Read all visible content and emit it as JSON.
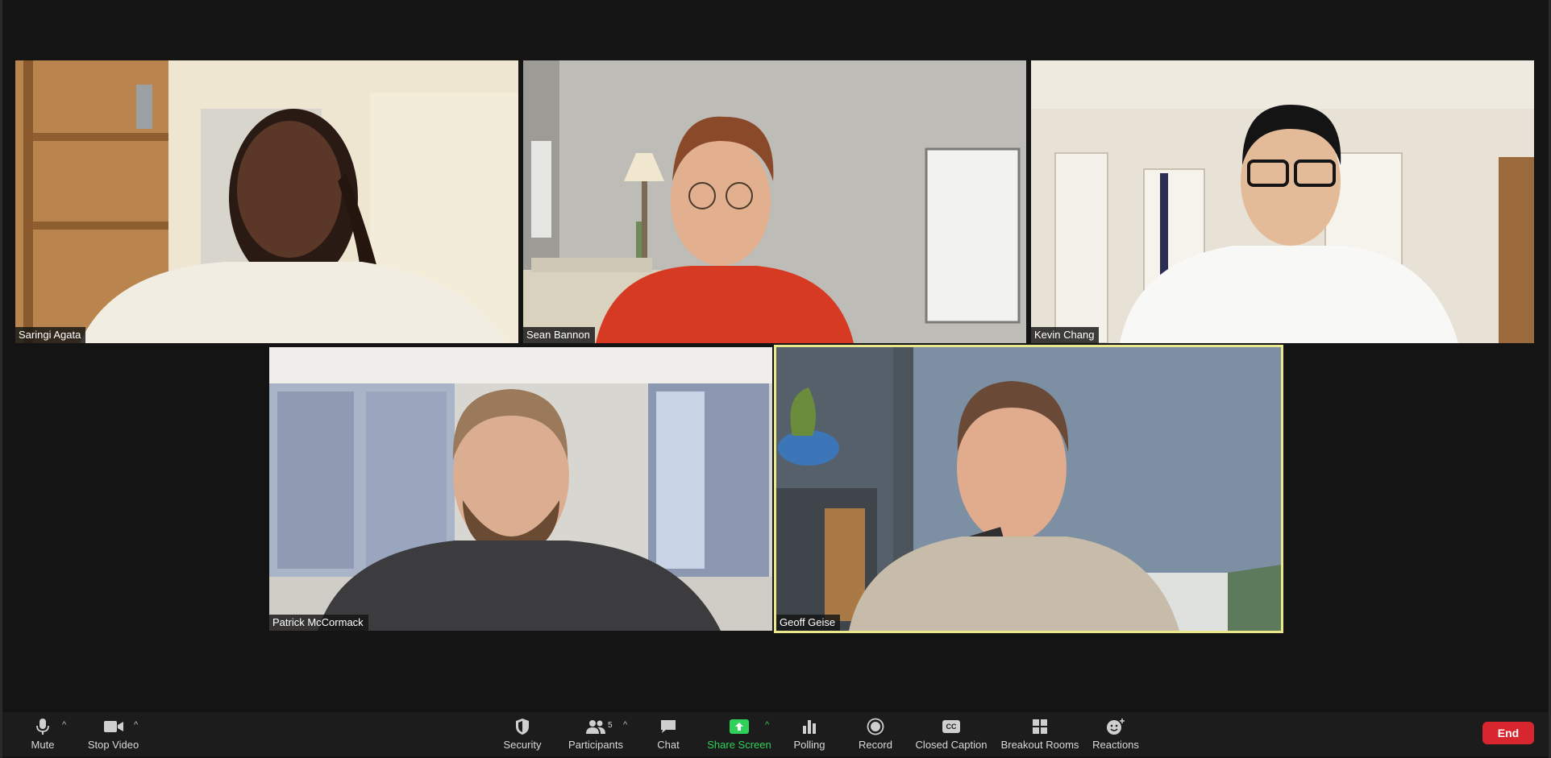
{
  "participants": [
    {
      "name": "Saringi Agata",
      "active": false
    },
    {
      "name": "Sean Bannon",
      "active": false
    },
    {
      "name": "Kevin Chang",
      "active": false
    },
    {
      "name": "Patrick McCormack",
      "active": false
    },
    {
      "name": "Geoff Geise",
      "active": true
    }
  ],
  "toolbar": {
    "mute": "Mute",
    "stop_video": "Stop Video",
    "security": "Security",
    "participants": "Participants",
    "participants_count": "5",
    "chat": "Chat",
    "share_screen": "Share Screen",
    "polling": "Polling",
    "record": "Record",
    "closed_caption": "Closed Caption",
    "cc_glyph": "CC",
    "breakout_rooms": "Breakout Rooms",
    "reactions": "Reactions",
    "end": "End"
  },
  "icons": {
    "mute": "microphone-icon",
    "stop_video": "video-camera-icon",
    "security": "shield-icon",
    "participants": "people-icon",
    "chat": "chat-bubble-icon",
    "share_screen": "share-arrow-icon",
    "polling": "bar-chart-icon",
    "record": "record-icon",
    "closed_caption": "cc-icon",
    "breakout_rooms": "grid-icon",
    "reactions": "smiley-plus-icon"
  },
  "colors": {
    "background": "#141414",
    "toolbar": "#1c1c1c",
    "share_green": "#2fd15a",
    "end_red": "#d8262f",
    "active_speaker_border": "#e9e88c"
  }
}
